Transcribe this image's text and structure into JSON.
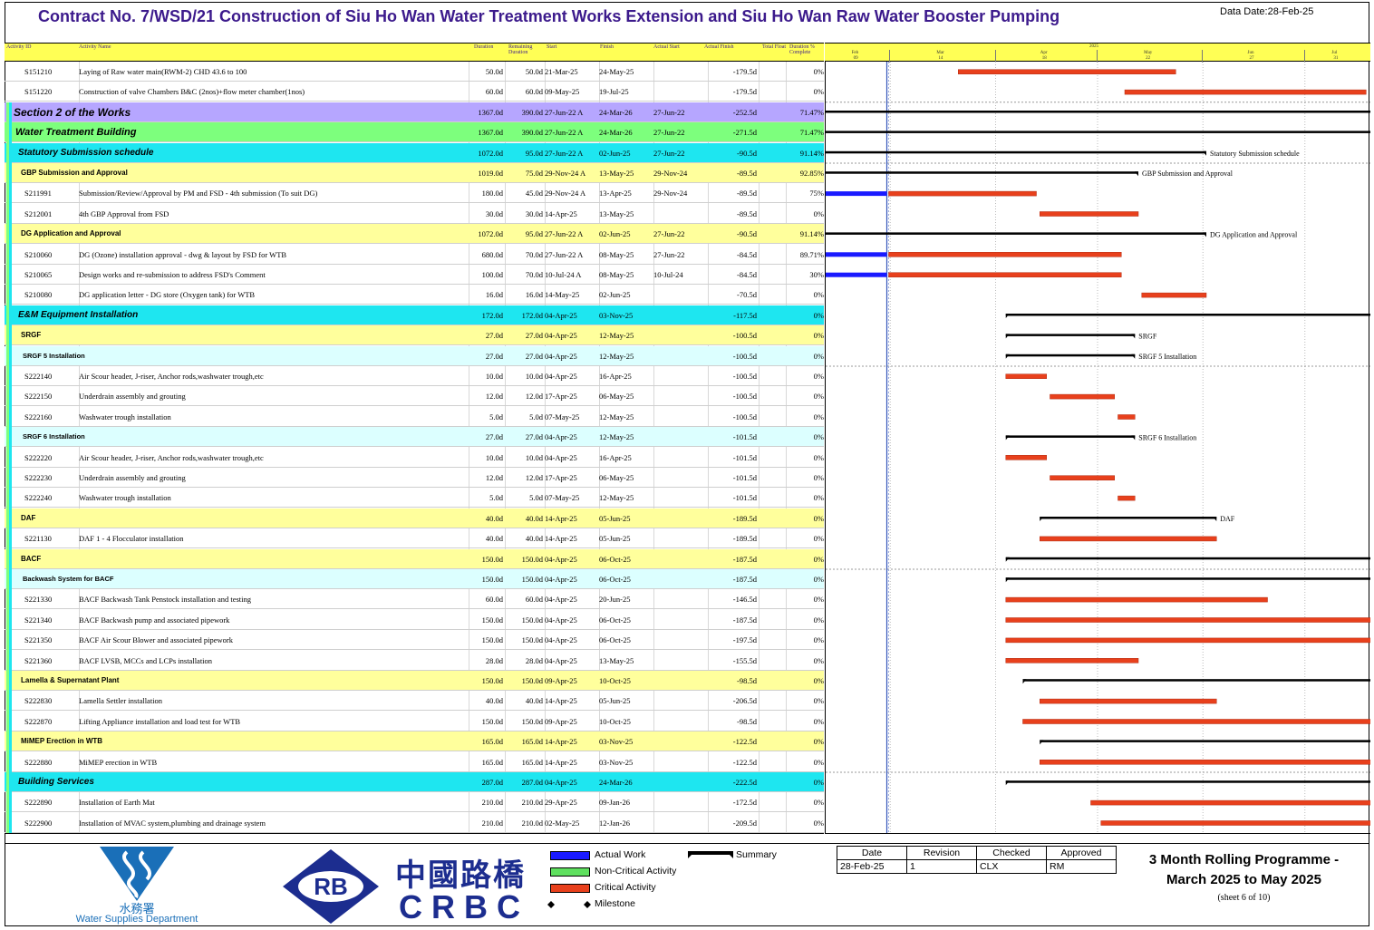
{
  "header": {
    "title": "Contract No. 7/WSD/21 Construction of Siu Ho Wan Water Treatment Works Extension and Siu Ho Wan Raw Water Booster Pumping",
    "data_date": "Data Date:28-Feb-25"
  },
  "columns": {
    "id": "Activity ID",
    "name": "Activity Name",
    "orig": "Duration",
    "rem": "Remaining Duration",
    "start": "Start",
    "finish": "Finish",
    "astart": "Actual Start",
    "afinish": "Actual Finish",
    "float": "Total Float",
    "pct": "Duration % Complete"
  },
  "timescale": {
    "year": "2025",
    "months": [
      "Feb",
      "Mar",
      "Apr",
      "May",
      "Jun",
      "Jul"
    ],
    "weeks": [
      "09",
      "14",
      "18",
      "22",
      "27",
      "31"
    ]
  },
  "rows": [
    {
      "type": "act",
      "id": "S151210",
      "name": "Laying of Raw water main(RWM-2) CHD 43.6 to 100",
      "orig": "50.0d",
      "rem": "50.0d",
      "start": "21-Mar-25",
      "finish": "24-May-25",
      "astart": "",
      "float": "-179.5d",
      "pct": "0%"
    },
    {
      "type": "act",
      "id": "S151220",
      "name": "Construction of valve Chambers B&C (2nos)+flow meter chamber(1nos)",
      "orig": "60.0d",
      "rem": "60.0d",
      "start": "09-May-25",
      "finish": "19-Jul-25",
      "astart": "",
      "float": "-179.5d",
      "pct": "0%"
    },
    {
      "type": "grp",
      "level": 1,
      "name": "Section 2 of the Works",
      "orig": "1367.0d",
      "rem": "390.0d",
      "start": "27-Jun-22 A",
      "finish": "24-Mar-26",
      "astart": "27-Jun-22",
      "float": "-252.5d",
      "pct": "71.47%"
    },
    {
      "type": "grp",
      "level": 2,
      "name": "Water Treatment Building",
      "orig": "1367.0d",
      "rem": "390.0d",
      "start": "27-Jun-22 A",
      "finish": "24-Mar-26",
      "astart": "27-Jun-22",
      "float": "-271.5d",
      "pct": "71.47%"
    },
    {
      "type": "grp",
      "level": 3,
      "name": "Statutory Submission schedule",
      "orig": "1072.0d",
      "rem": "95.0d",
      "start": "27-Jun-22 A",
      "finish": "02-Jun-25",
      "astart": "27-Jun-22",
      "float": "-90.5d",
      "pct": "91.14%"
    },
    {
      "type": "grp",
      "level": 4,
      "name": "GBP Submission and Approval",
      "orig": "1019.0d",
      "rem": "75.0d",
      "start": "29-Nov-24 A",
      "finish": "13-May-25",
      "astart": "29-Nov-24",
      "float": "-89.5d",
      "pct": "92.85%"
    },
    {
      "type": "act",
      "id": "S211991",
      "name": "Submission/Review/Approval by PM and FSD - 4th submission (To suit DG)",
      "orig": "180.0d",
      "rem": "45.0d",
      "start": "29-Nov-24 A",
      "finish": "13-Apr-25",
      "astart": "29-Nov-24",
      "float": "-89.5d",
      "pct": "75%"
    },
    {
      "type": "act",
      "id": "S212001",
      "name": "4th GBP Approval from FSD",
      "orig": "30.0d",
      "rem": "30.0d",
      "start": "14-Apr-25",
      "finish": "13-May-25",
      "astart": "",
      "float": "-89.5d",
      "pct": "0%"
    },
    {
      "type": "grp",
      "level": 4,
      "name": "DG Application and Approval",
      "orig": "1072.0d",
      "rem": "95.0d",
      "start": "27-Jun-22 A",
      "finish": "02-Jun-25",
      "astart": "27-Jun-22",
      "float": "-90.5d",
      "pct": "91.14%"
    },
    {
      "type": "act",
      "id": "S210060",
      "name": "DG (Ozone) installation approval - dwg & layout by FSD for WTB",
      "orig": "680.0d",
      "rem": "70.0d",
      "start": "27-Jun-22 A",
      "finish": "08-May-25",
      "astart": "27-Jun-22",
      "float": "-84.5d",
      "pct": "89.71%"
    },
    {
      "type": "act",
      "id": "S210065",
      "name": "Design works and re-submission to address FSD's Comment",
      "orig": "100.0d",
      "rem": "70.0d",
      "start": "10-Jul-24 A",
      "finish": "08-May-25",
      "astart": "10-Jul-24",
      "float": "-84.5d",
      "pct": "30%"
    },
    {
      "type": "act",
      "id": "S210080",
      "name": "DG application letter - DG store (Oxygen tank) for WTB",
      "orig": "16.0d",
      "rem": "16.0d",
      "start": "14-May-25",
      "finish": "02-Jun-25",
      "astart": "",
      "float": "-70.5d",
      "pct": "0%"
    },
    {
      "type": "grp",
      "level": 3,
      "name": "E&M Equipment Installation",
      "orig": "172.0d",
      "rem": "172.0d",
      "start": "04-Apr-25",
      "finish": "03-Nov-25",
      "astart": "",
      "float": "-117.5d",
      "pct": "0%"
    },
    {
      "type": "grp",
      "level": 4,
      "name": "SRGF",
      "orig": "27.0d",
      "rem": "27.0d",
      "start": "04-Apr-25",
      "finish": "12-May-25",
      "astart": "",
      "float": "-100.5d",
      "pct": "0%"
    },
    {
      "type": "grp",
      "level": 5,
      "name": "SRGF 5 Installation",
      "orig": "27.0d",
      "rem": "27.0d",
      "start": "04-Apr-25",
      "finish": "12-May-25",
      "astart": "",
      "float": "-100.5d",
      "pct": "0%"
    },
    {
      "type": "act",
      "id": "S222140",
      "name": "Air Scour header, J-riser, Anchor rods,washwater trough,etc",
      "orig": "10.0d",
      "rem": "10.0d",
      "start": "04-Apr-25",
      "finish": "16-Apr-25",
      "astart": "",
      "float": "-100.5d",
      "pct": "0%"
    },
    {
      "type": "act",
      "id": "S222150",
      "name": "Underdrain assembly and grouting",
      "orig": "12.0d",
      "rem": "12.0d",
      "start": "17-Apr-25",
      "finish": "06-May-25",
      "astart": "",
      "float": "-100.5d",
      "pct": "0%"
    },
    {
      "type": "act",
      "id": "S222160",
      "name": "Washwater trough installation",
      "orig": "5.0d",
      "rem": "5.0d",
      "start": "07-May-25",
      "finish": "12-May-25",
      "astart": "",
      "float": "-100.5d",
      "pct": "0%"
    },
    {
      "type": "grp",
      "level": 5,
      "name": "SRGF 6 Installation",
      "orig": "27.0d",
      "rem": "27.0d",
      "start": "04-Apr-25",
      "finish": "12-May-25",
      "astart": "",
      "float": "-101.5d",
      "pct": "0%"
    },
    {
      "type": "act",
      "id": "S222220",
      "name": "Air Scour header, J-riser, Anchor rods,washwater trough,etc",
      "orig": "10.0d",
      "rem": "10.0d",
      "start": "04-Apr-25",
      "finish": "16-Apr-25",
      "astart": "",
      "float": "-101.5d",
      "pct": "0%"
    },
    {
      "type": "act",
      "id": "S222230",
      "name": "Underdrain assembly and grouting",
      "orig": "12.0d",
      "rem": "12.0d",
      "start": "17-Apr-25",
      "finish": "06-May-25",
      "astart": "",
      "float": "-101.5d",
      "pct": "0%"
    },
    {
      "type": "act",
      "id": "S222240",
      "name": "Washwater trough installation",
      "orig": "5.0d",
      "rem": "5.0d",
      "start": "07-May-25",
      "finish": "12-May-25",
      "astart": "",
      "float": "-101.5d",
      "pct": "0%"
    },
    {
      "type": "grp",
      "level": 4,
      "name": "DAF",
      "orig": "40.0d",
      "rem": "40.0d",
      "start": "14-Apr-25",
      "finish": "05-Jun-25",
      "astart": "",
      "float": "-189.5d",
      "pct": "0%"
    },
    {
      "type": "act",
      "id": "S221130",
      "name": "DAF 1 - 4 Flocculator installation",
      "orig": "40.0d",
      "rem": "40.0d",
      "start": "14-Apr-25",
      "finish": "05-Jun-25",
      "astart": "",
      "float": "-189.5d",
      "pct": "0%"
    },
    {
      "type": "grp",
      "level": 4,
      "name": "BACF",
      "orig": "150.0d",
      "rem": "150.0d",
      "start": "04-Apr-25",
      "finish": "06-Oct-25",
      "astart": "",
      "float": "-187.5d",
      "pct": "0%"
    },
    {
      "type": "grp",
      "level": 5,
      "name": "Backwash System for BACF",
      "orig": "150.0d",
      "rem": "150.0d",
      "start": "04-Apr-25",
      "finish": "06-Oct-25",
      "astart": "",
      "float": "-187.5d",
      "pct": "0%"
    },
    {
      "type": "act",
      "id": "S221330",
      "name": "BACF Backwash Tank Penstock installation and testing",
      "orig": "60.0d",
      "rem": "60.0d",
      "start": "04-Apr-25",
      "finish": "20-Jun-25",
      "astart": "",
      "float": "-146.5d",
      "pct": "0%"
    },
    {
      "type": "act",
      "id": "S221340",
      "name": "BACF Backwash pump and associated pipework",
      "orig": "150.0d",
      "rem": "150.0d",
      "start": "04-Apr-25",
      "finish": "06-Oct-25",
      "astart": "",
      "float": "-187.5d",
      "pct": "0%"
    },
    {
      "type": "act",
      "id": "S221350",
      "name": "BACF Air Scour Blower and associated pipework",
      "orig": "150.0d",
      "rem": "150.0d",
      "start": "04-Apr-25",
      "finish": "06-Oct-25",
      "astart": "",
      "float": "-197.5d",
      "pct": "0%"
    },
    {
      "type": "act",
      "id": "S221360",
      "name": "BACF LVSB, MCCs and LCPs installation",
      "orig": "28.0d",
      "rem": "28.0d",
      "start": "04-Apr-25",
      "finish": "13-May-25",
      "astart": "",
      "float": "-155.5d",
      "pct": "0%"
    },
    {
      "type": "grp",
      "level": 4,
      "name": "Lamella & Supernatant Plant",
      "orig": "150.0d",
      "rem": "150.0d",
      "start": "09-Apr-25",
      "finish": "10-Oct-25",
      "astart": "",
      "float": "-98.5d",
      "pct": "0%"
    },
    {
      "type": "act",
      "id": "S222830",
      "name": "Lamella Settler installation",
      "orig": "40.0d",
      "rem": "40.0d",
      "start": "14-Apr-25",
      "finish": "05-Jun-25",
      "astart": "",
      "float": "-206.5d",
      "pct": "0%"
    },
    {
      "type": "act",
      "id": "S222870",
      "name": "Lifting Appliance installation and load test for WTB",
      "orig": "150.0d",
      "rem": "150.0d",
      "start": "09-Apr-25",
      "finish": "10-Oct-25",
      "astart": "",
      "float": "-98.5d",
      "pct": "0%"
    },
    {
      "type": "grp",
      "level": 4,
      "name": "MiMEP Erection in WTB",
      "orig": "165.0d",
      "rem": "165.0d",
      "start": "14-Apr-25",
      "finish": "03-Nov-25",
      "astart": "",
      "float": "-122.5d",
      "pct": "0%"
    },
    {
      "type": "act",
      "id": "S222880",
      "name": "MiMEP erection in WTB",
      "orig": "165.0d",
      "rem": "165.0d",
      "start": "14-Apr-25",
      "finish": "03-Nov-25",
      "astart": "",
      "float": "-122.5d",
      "pct": "0%"
    },
    {
      "type": "grp",
      "level": 3,
      "name": "Building Services",
      "orig": "287.0d",
      "rem": "287.0d",
      "start": "04-Apr-25",
      "finish": "24-Mar-26",
      "astart": "",
      "float": "-222.5d",
      "pct": "0%"
    },
    {
      "type": "act",
      "id": "S222890",
      "name": "Installation of Earth Mat",
      "orig": "210.0d",
      "rem": "210.0d",
      "start": "29-Apr-25",
      "finish": "09-Jan-26",
      "astart": "",
      "float": "-172.5d",
      "pct": "0%"
    },
    {
      "type": "act",
      "id": "S222900",
      "name": "Installation of MVAC system,plumbing and drainage system",
      "orig": "210.0d",
      "rem": "210.0d",
      "start": "02-May-25",
      "finish": "12-Jan-26",
      "astart": "",
      "float": "-209.5d",
      "pct": "0%"
    }
  ],
  "gantt_labels": {
    "4": "Statutory Submission schedule",
    "5": "GBP Submission and Approval",
    "8": "DG Application and Approval",
    "13": "SRGF",
    "14": "SRGF 5 Installation",
    "18": "SRGF 6 Installation",
    "22": "DAF"
  },
  "colors": {
    "actual": "#1a1aff",
    "noncritical": "#5fe05f",
    "critical": "#e8401c",
    "summary": "#000000",
    "section": "#b6a6ff",
    "building": "#7dff7d",
    "cyan": "#1ee6f0",
    "yellow": "#ffff9c",
    "lightcyan": "#dcffff"
  },
  "legend": {
    "actual_work": "Actual Work",
    "non_critical": "Non-Critical Activity",
    "critical": "Critical Activity",
    "milestone": "Milestone",
    "summary": "Summary"
  },
  "revision_table": {
    "headers": [
      "Date",
      "Revision",
      "Checked",
      "Approved"
    ],
    "values": [
      "28-Feb-25",
      "1",
      "CLX",
      "RM"
    ]
  },
  "programme": {
    "line1": "3 Month Rolling Programme -",
    "line2": "March 2025 to May 2025",
    "sheet": "(sheet 6 of 10)"
  },
  "logos": {
    "wsd_cn": "水務署",
    "wsd_en": "Water Supplies Department",
    "rb": "RB",
    "crbc_cn": "中國路橋",
    "crbc_en": "CRBC"
  }
}
